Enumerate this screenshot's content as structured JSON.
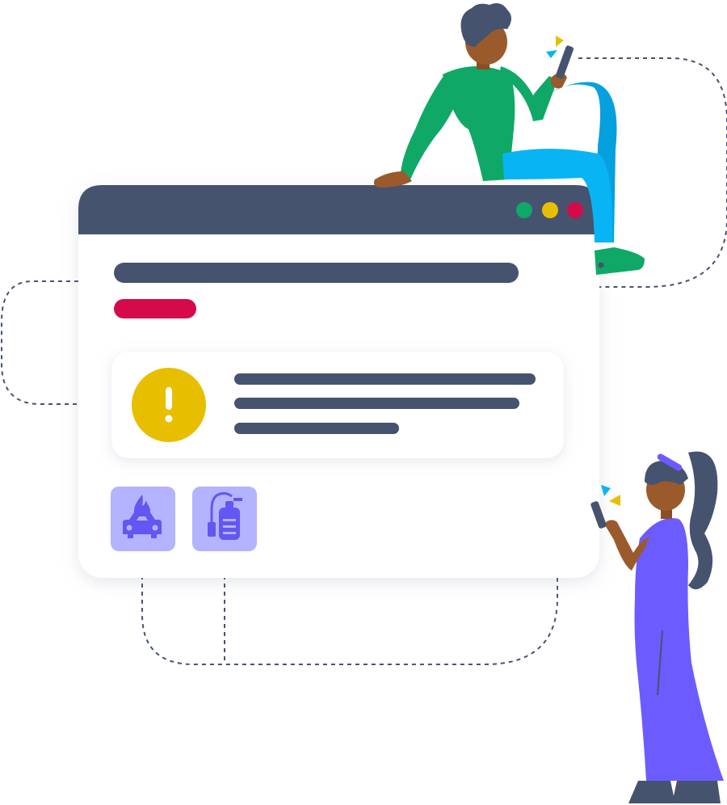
{
  "palette": {
    "titlebar": "#45536f",
    "window_bg": "#ffffff",
    "window_shadow": "#e6e8ee",
    "placeholder_dark": "#45536f",
    "placeholder_red": "#d50a4a",
    "dot_green": "#0fa86a",
    "dot_yellow": "#e8bf00",
    "dot_red": "#d50a4a",
    "alert_yellow": "#e8bf00",
    "icon_tile": "#b3b3ff",
    "icon_ink": "#6257f2",
    "connector": "#45536f",
    "shirt_green": "#10a866",
    "jeans_blue": "#08b4f4",
    "dress_purple": "#6c5cff",
    "skin": "#9b5a2c",
    "hair": "#45536f"
  },
  "window": {
    "icons": [
      "fire-car-icon",
      "fire-extinguisher-icon"
    ]
  }
}
